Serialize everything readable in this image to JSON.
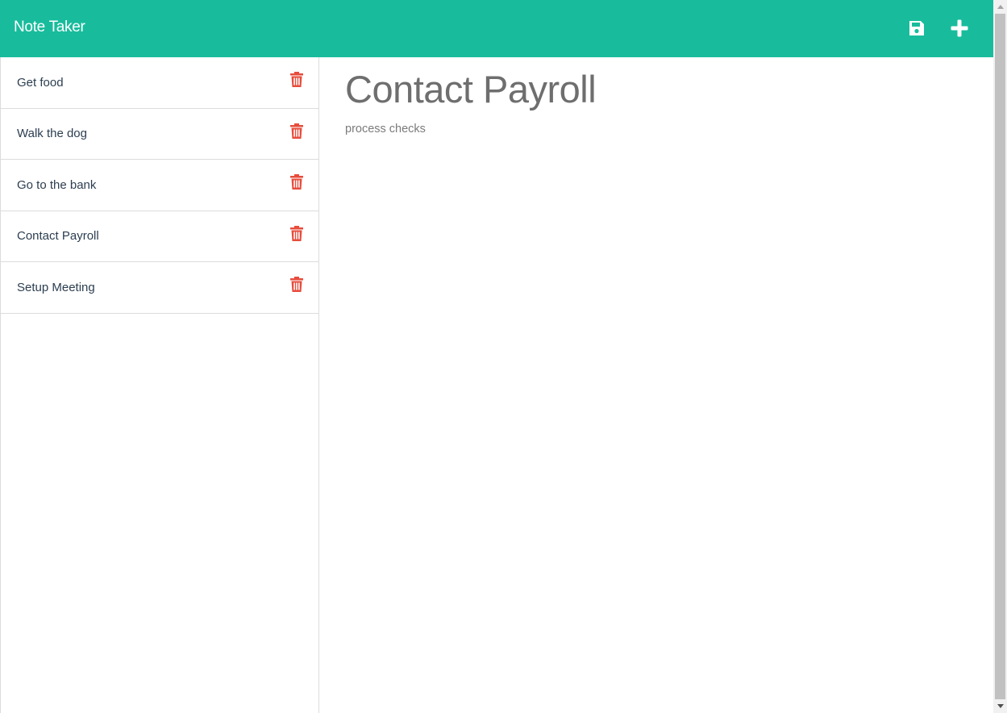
{
  "app": {
    "title": "Note Taker",
    "accent_color": "#18bc9c",
    "danger_color": "#e74c3c"
  },
  "toolbar": {
    "save_icon": "floppy-disk-icon",
    "add_icon": "plus-icon"
  },
  "sidebar": {
    "notes": [
      {
        "title": "Get food"
      },
      {
        "title": "Walk the dog"
      },
      {
        "title": "Go to the bank"
      },
      {
        "title": "Contact Payroll"
      },
      {
        "title": "Setup Meeting"
      }
    ],
    "delete_icon": "trash-icon"
  },
  "main": {
    "note_title": "Contact Payroll",
    "note_text": "process checks"
  }
}
